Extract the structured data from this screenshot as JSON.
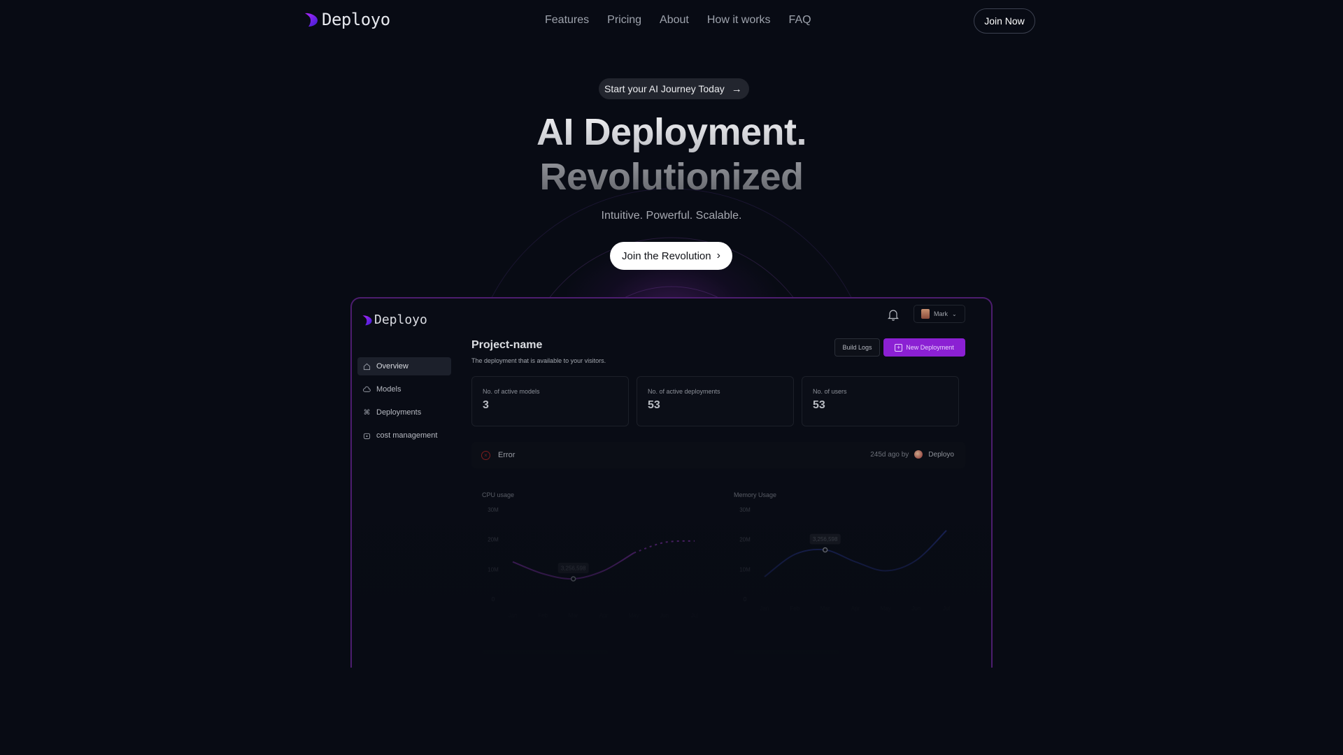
{
  "nav": {
    "brand": "Deployo",
    "links": [
      "Features",
      "Pricing",
      "About",
      "How it works",
      "FAQ"
    ],
    "cta": "Join Now"
  },
  "hero": {
    "badge": "Start your AI Journey Today",
    "badge_icon": "arrow-right-icon",
    "title_line1": "AI Deployment.",
    "title_line2": "Revolutionized",
    "tagline": "Intuitive. Powerful. Scalable.",
    "cta": "Join the Revolution",
    "cta_icon": "chevron-right-icon"
  },
  "colors": {
    "background": "#080b14",
    "accent_purple": "#8b20d3",
    "dashboard_border": "#4c1d6e",
    "cpu_line": "#6b2a8f",
    "memory_line": "#1e2a6b",
    "error": "#7f1d1d"
  },
  "dashboard": {
    "brand": "Deployo",
    "sidebar": [
      {
        "label": "Overview",
        "icon": "home-icon",
        "active": true
      },
      {
        "label": "Models",
        "icon": "cloud-icon",
        "active": false
      },
      {
        "label": "Deployments",
        "icon": "command-icon",
        "active": false
      },
      {
        "label": "cost management",
        "icon": "wallet-icon",
        "active": false
      }
    ],
    "user": {
      "name": "Mark"
    },
    "project_title": "Project-name",
    "project_subtitle": "The deployment that is available to your visitors.",
    "build_logs": "Build Logs",
    "new_deployment": "New Deployment",
    "stats": [
      {
        "label": "No. of active models",
        "value": "3"
      },
      {
        "label": "No. of active deployments",
        "value": "53"
      },
      {
        "label": "No. of users",
        "value": "53"
      }
    ],
    "status": {
      "label": "Error",
      "time": "245d ago by",
      "author": "Deployo"
    }
  },
  "chart_data": [
    {
      "type": "line",
      "title": "CPU usage",
      "categories": [
        "Jan",
        "Feb",
        "Mar",
        "Apr",
        "May",
        "Jun",
        "Jul"
      ],
      "y_ticks": [
        "0",
        "10M",
        "20M",
        "30M"
      ],
      "ylim": [
        0,
        30000000
      ],
      "series": [
        {
          "name": "CPU usage",
          "values": [
            12500000,
            8500000,
            6800000,
            9500000,
            15500000,
            19000000,
            19500000
          ],
          "projected_from_index": 4
        }
      ],
      "tooltip": {
        "category": "Mar",
        "label": "3,256,598"
      },
      "grid": false
    },
    {
      "type": "line",
      "title": "Memory Usage",
      "categories": [
        "Jan",
        "Feb",
        "Mar",
        "Apr",
        "May",
        "Jun",
        "Jul"
      ],
      "y_ticks": [
        "0",
        "10M",
        "20M",
        "30M"
      ],
      "ylim": [
        0,
        30000000
      ],
      "series": [
        {
          "name": "Memory Usage",
          "values": [
            7500000,
            15000000,
            16500000,
            12500000,
            9500000,
            13000000,
            23000000
          ]
        }
      ],
      "tooltip": {
        "category": "Mar",
        "label": "3,256,598"
      },
      "grid": false
    }
  ]
}
